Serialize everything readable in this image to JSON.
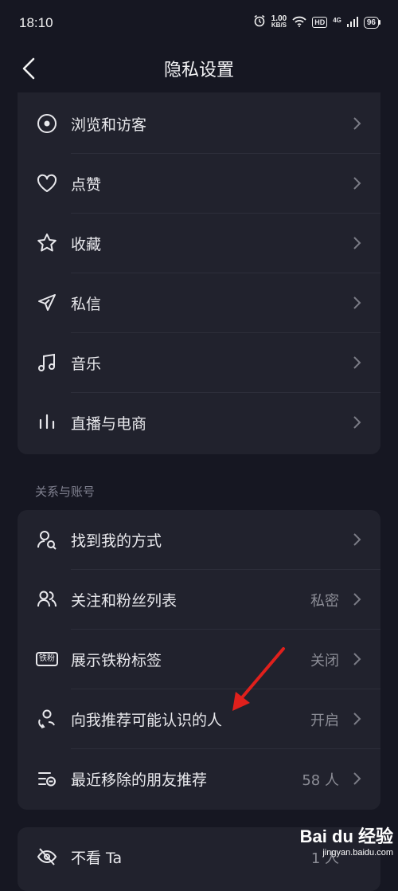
{
  "status_bar": {
    "time": "18:10",
    "speed_value": "1.00",
    "speed_unit": "KB/S",
    "hd_label": "HD",
    "network_label": "4G",
    "battery": "96"
  },
  "header": {
    "title": "隐私设置"
  },
  "group1": {
    "items": [
      {
        "label": "浏览和访客",
        "icon": "eye-icon"
      },
      {
        "label": "点赞",
        "icon": "heart-icon"
      },
      {
        "label": "收藏",
        "icon": "star-icon"
      },
      {
        "label": "私信",
        "icon": "send-icon"
      },
      {
        "label": "音乐",
        "icon": "music-note-icon"
      },
      {
        "label": "直播与电商",
        "icon": "live-bars-icon"
      }
    ]
  },
  "group2": {
    "title": "关系与账号",
    "items": [
      {
        "label": "找到我的方式",
        "value": "",
        "icon": "find-user-icon"
      },
      {
        "label": "关注和粉丝列表",
        "value": "私密",
        "icon": "users-icon"
      },
      {
        "label": "展示铁粉标签",
        "value": "关闭",
        "icon": "fan-badge-icon",
        "badge_text": "铁粉"
      },
      {
        "label": "向我推荐可能认识的人",
        "value": "开启",
        "icon": "recommend-user-icon"
      },
      {
        "label": "最近移除的朋友推荐",
        "value": "58 人",
        "icon": "removed-list-icon"
      }
    ]
  },
  "group3": {
    "items": [
      {
        "label": "不看 Ta",
        "value": "1 人",
        "icon": "eye-off-icon"
      }
    ]
  },
  "watermark": {
    "main": "Bai du 经验",
    "sub": "jingyan.baidu.com"
  },
  "colors": {
    "background": "#161722",
    "card": "#21222d",
    "annotation_arrow": "#e0201c"
  }
}
